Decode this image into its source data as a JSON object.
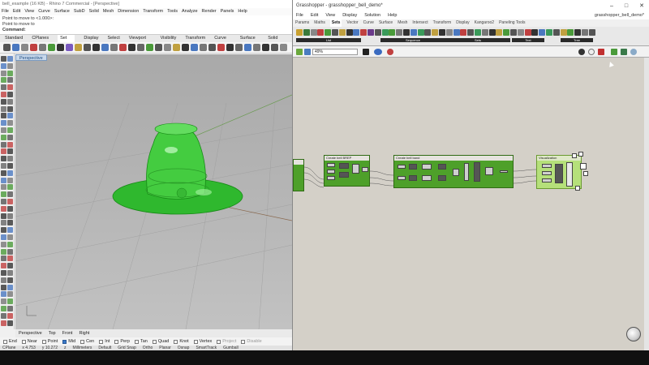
{
  "rhino": {
    "title": "bell_example (16 KB) - Rhino 7 Commercial - [Perspective]",
    "menu": [
      "File",
      "Edit",
      "View",
      "Curve",
      "Surface",
      "SubD",
      "Solid",
      "Mesh",
      "Dimension",
      "Transform",
      "Tools",
      "Analyze",
      "Render",
      "Panels",
      "Help"
    ],
    "command_history": [
      "Point to move to <1.000>:",
      "Point to move to"
    ],
    "command_prompt": "Command:",
    "tabs": [
      "Standard",
      "CPlanes",
      "Set View",
      "Display",
      "Select",
      "Viewport Layout",
      "Visibility",
      "Transform",
      "Curve Tools",
      "Surface Tools",
      "Solid Tools"
    ],
    "active_tab": "Set View",
    "viewport_label": "Perspective",
    "view_tabs": [
      "Perspective",
      "Top",
      "Front",
      "Right"
    ],
    "snaps": [
      {
        "label": "End",
        "on": false
      },
      {
        "label": "Near",
        "on": false
      },
      {
        "label": "Point",
        "on": false
      },
      {
        "label": "Mid",
        "on": true
      },
      {
        "label": "Cen",
        "on": false
      },
      {
        "label": "Int",
        "on": false
      },
      {
        "label": "Perp",
        "on": false
      },
      {
        "label": "Tan",
        "on": false
      },
      {
        "label": "Quad",
        "on": false
      },
      {
        "label": "Knot",
        "on": false
      },
      {
        "label": "Vertex",
        "on": false
      },
      {
        "label": "Project",
        "on": false
      },
      {
        "label": "Disable",
        "on": false
      }
    ],
    "status": [
      "CPlane",
      "x 4.753",
      "y 10.272",
      "z",
      "Millimeters",
      "Default",
      "Grid Snap",
      "Ortho",
      "Planar",
      "Osnap",
      "SmartTrack",
      "Gumball"
    ]
  },
  "grasshopper": {
    "title": "Grasshopper - grasshopper_bell_demo*",
    "doc_name": "grasshopper_bell_demo*",
    "menu": [
      "File",
      "Edit",
      "View",
      "Display",
      "Solution",
      "Help"
    ],
    "tabs": [
      "Params",
      "Maths",
      "Sets",
      "Vector",
      "Curve",
      "Surface",
      "Mesh",
      "Intersect",
      "Transform",
      "Display",
      "Kangaroo2",
      "Paneling Tools"
    ],
    "active_tab": "Sets",
    "ribbon_groups": [
      "List",
      "Sequence",
      "Sets",
      "Text",
      "Tree"
    ],
    "zoom": "49%",
    "groups": [
      {
        "title": ""
      },
      {
        "title": "Create bell BREP"
      },
      {
        "title": "Create bell band"
      },
      {
        "title": "Visualization"
      }
    ]
  },
  "colors": {
    "gh_group_green": "#4ea02a",
    "gh_visual_green": "#b5e07a",
    "gh_canvas": "#d4d0c8",
    "bell_green": "#3cc43a"
  }
}
